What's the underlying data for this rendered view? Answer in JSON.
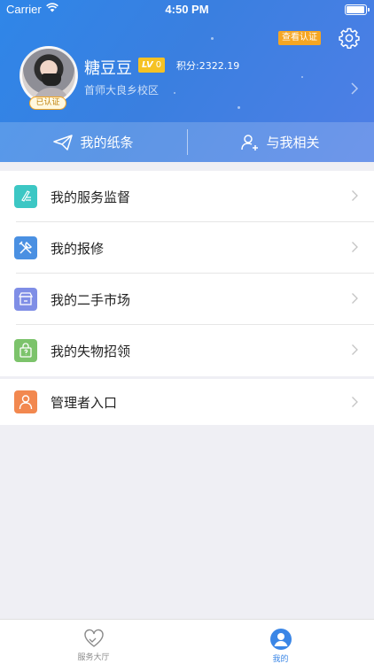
{
  "status_bar": {
    "carrier": "Carrier",
    "time": "4:50 PM"
  },
  "profile": {
    "verify_button": "查看认证",
    "verified_badge": "已认证",
    "username": "糖豆豆",
    "level_prefix": "LV",
    "level_value": "0",
    "points": "积分:2322.19",
    "campus": "首师大良乡校区"
  },
  "top_tabs": [
    {
      "label": "我的纸条",
      "icon": "paper-plane-icon"
    },
    {
      "label": "与我相关",
      "icon": "user-related-icon"
    }
  ],
  "menu_main": [
    {
      "label": "我的服务监督",
      "icon": "pen-note-icon",
      "color": "#3cc7c4"
    },
    {
      "label": "我的报修",
      "icon": "repair-tools-icon",
      "color": "#4a90e2"
    },
    {
      "label": "我的二手市场",
      "icon": "market-icon",
      "color": "#7f8ee6"
    },
    {
      "label": "我的失物招领",
      "icon": "lost-found-bag-icon",
      "color": "#7cc36b"
    }
  ],
  "menu_admin": [
    {
      "label": "管理者入口",
      "icon": "admin-person-icon",
      "color": "#f2884f"
    }
  ],
  "bottom_nav": [
    {
      "label": "服务大厅",
      "icon": "heart-hands-icon",
      "active": false
    },
    {
      "label": "我的",
      "icon": "profile-icon",
      "active": true
    }
  ],
  "colors": {
    "accent": "#3a86e6",
    "header_start": "#2f86e8",
    "header_end": "#4f7fe6",
    "badge": "#f5a623"
  }
}
